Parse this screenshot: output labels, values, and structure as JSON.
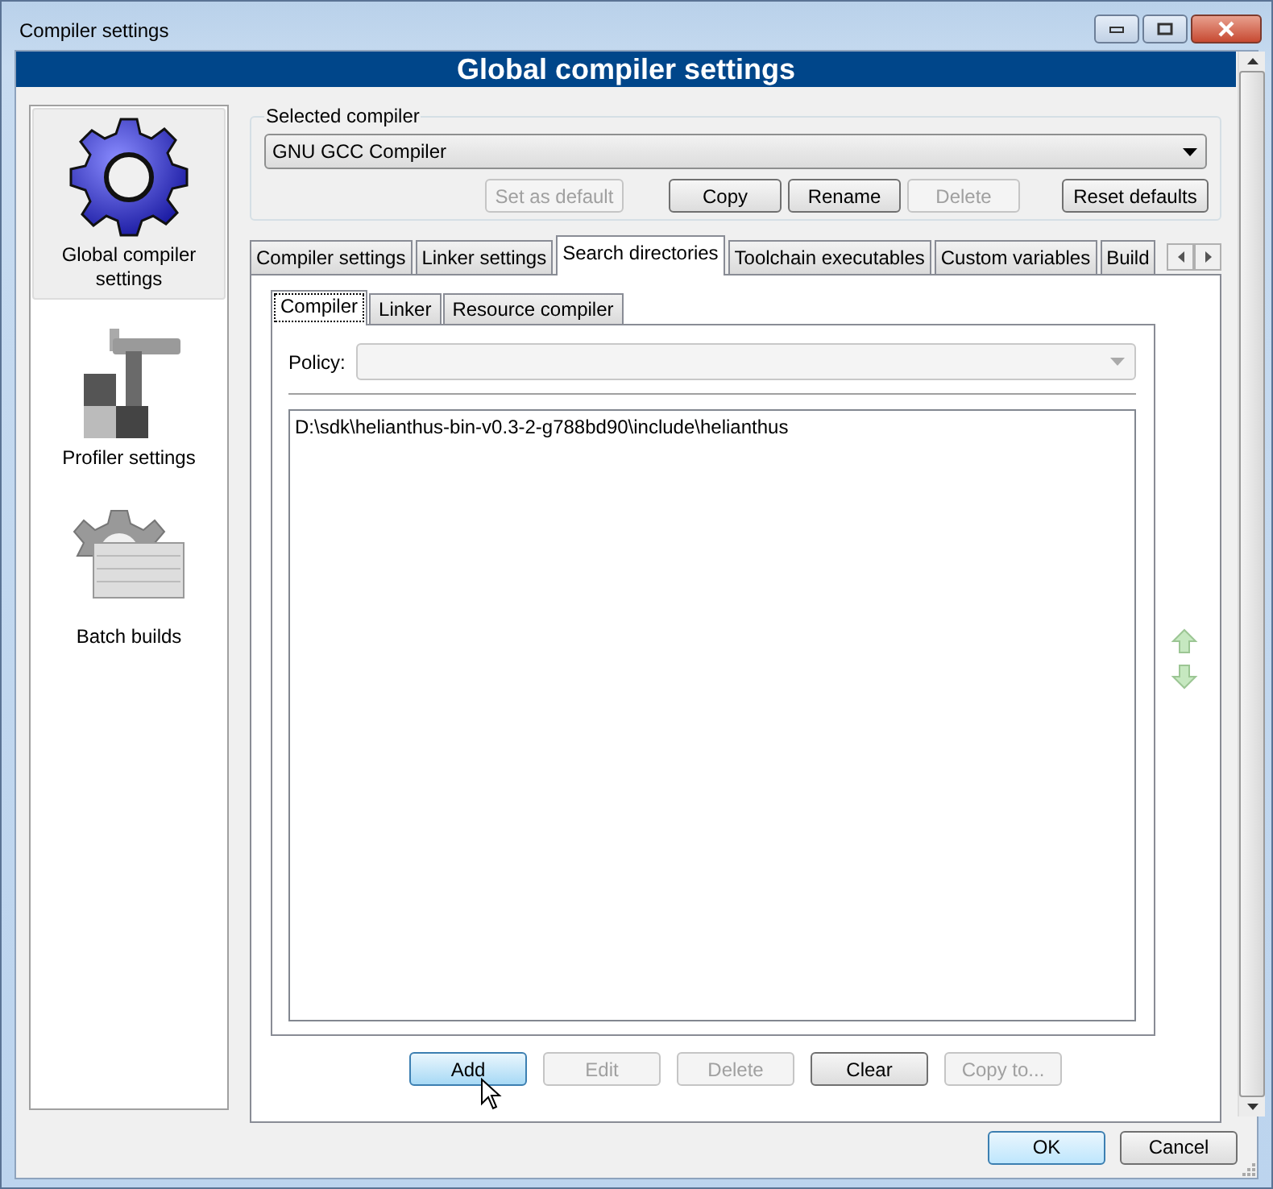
{
  "window": {
    "title": "Compiler settings"
  },
  "header": "Global compiler settings",
  "sidebar": {
    "items": [
      {
        "label": "Global compiler settings",
        "kind": "gear",
        "selected": true
      },
      {
        "label": "Profiler settings",
        "kind": "profiler",
        "selected": false
      },
      {
        "label": "Batch builds",
        "kind": "batch",
        "selected": false
      }
    ]
  },
  "selected_compiler": {
    "label": "Selected compiler",
    "value": "GNU GCC Compiler",
    "buttons": [
      {
        "label": "Set as default",
        "disabled": true
      },
      {
        "label": "Copy",
        "disabled": false
      },
      {
        "label": "Rename",
        "disabled": false
      },
      {
        "label": "Delete",
        "disabled": true
      },
      {
        "label": "Reset defaults",
        "disabled": false
      }
    ]
  },
  "tabs": [
    {
      "label": "Compiler settings",
      "selected": false
    },
    {
      "label": "Linker settings",
      "selected": false
    },
    {
      "label": "Search directories",
      "selected": true
    },
    {
      "label": "Toolchain executables",
      "selected": false
    },
    {
      "label": "Custom variables",
      "selected": false
    },
    {
      "label": "Build",
      "selected": false
    }
  ],
  "subtabs": [
    {
      "label": "Compiler",
      "selected": true
    },
    {
      "label": "Linker",
      "selected": false
    },
    {
      "label": "Resource compiler",
      "selected": false
    }
  ],
  "policy": {
    "label": "Policy:",
    "disabled": true
  },
  "directories": [
    "D:\\sdk\\helianthus-bin-v0.3-2-g788bd90\\include\\helianthus"
  ],
  "list_buttons": [
    {
      "label": "Add",
      "disabled": false,
      "hovered": true
    },
    {
      "label": "Edit",
      "disabled": true,
      "hovered": false
    },
    {
      "label": "Delete",
      "disabled": true,
      "hovered": false
    },
    {
      "label": "Clear",
      "disabled": false,
      "hovered": false
    },
    {
      "label": "Copy to...",
      "disabled": true,
      "hovered": false
    }
  ],
  "dialog_buttons": [
    {
      "label": "OK",
      "default": true
    },
    {
      "label": "Cancel",
      "default": false
    }
  ]
}
